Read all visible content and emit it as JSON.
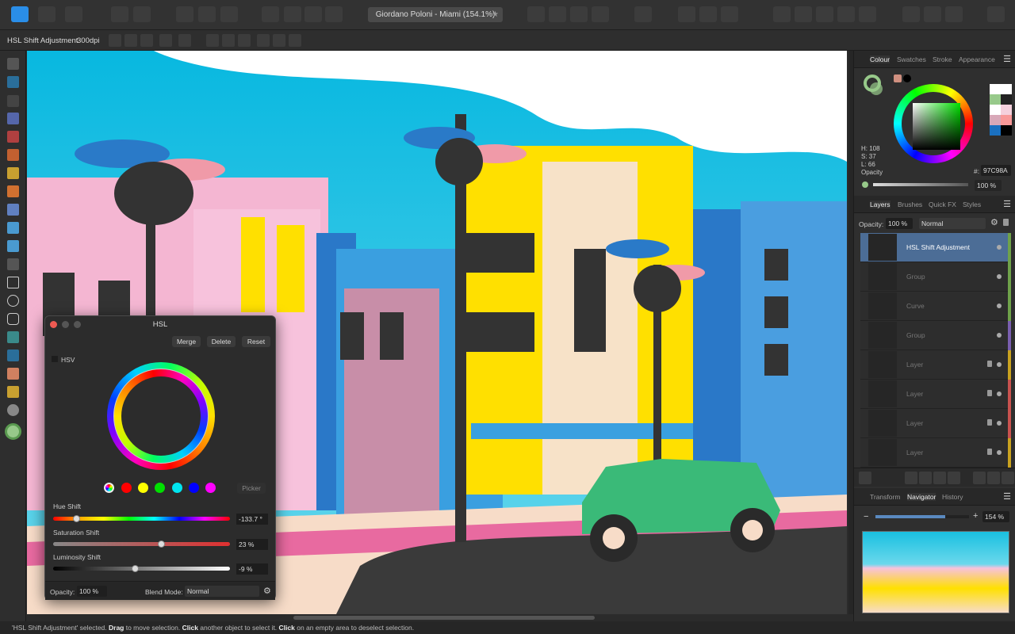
{
  "app": {
    "document_title": "Giordano Poloni - Miami (154.1%)"
  },
  "context_bar": {
    "selection": "HSL Shift Adjustment",
    "dpi": "300dpi"
  },
  "colour_panel": {
    "tabs": [
      "Colour",
      "Swatches",
      "Stroke",
      "Appearance"
    ],
    "h": "H: 108",
    "s": "S: 37",
    "l": "L: 66",
    "opacity_label": "Opacity",
    "hex_label": "#:",
    "hex": "97C98A",
    "opacity": "100 %",
    "current_colour": "#97C98A"
  },
  "layers_panel": {
    "tabs": [
      "Layers",
      "Brushes",
      "Quick FX",
      "Styles"
    ],
    "opacity_label": "Opacity:",
    "opacity": "100 %",
    "blend": "Normal",
    "layers": [
      {
        "name": "HSL Shift Adjustment",
        "selected": true,
        "tag": "#6fa24a"
      },
      {
        "name": "Group",
        "tag": "#6fa24a"
      },
      {
        "name": "Curve",
        "tag": "#6fa24a"
      },
      {
        "name": "Group",
        "tag": "#7a5fb0"
      },
      {
        "name": "Layer",
        "locked": true,
        "tag": "#c9a21f"
      },
      {
        "name": "Layer",
        "locked": true,
        "tag": "#c9524f"
      },
      {
        "name": "Layer",
        "locked": true,
        "tag": "#c9524f"
      },
      {
        "name": "Layer",
        "locked": true,
        "tag": "#c9a21f"
      },
      {
        "name": "Layer",
        "locked": true,
        "tag": "#c9a21f"
      }
    ]
  },
  "navigator_panel": {
    "tabs": [
      "Transform",
      "Navigator",
      "History"
    ],
    "zoom": "154 %",
    "zoom_minus": "−",
    "zoom_plus": "+"
  },
  "hsl_dialog": {
    "title": "HSL",
    "merge": "Merge",
    "delete": "Delete",
    "reset": "Reset",
    "hsv_label": "HSV",
    "picker": "Picker",
    "hue_label": "Hue Shift",
    "hue_value": "-133.7 °",
    "hue_fraction": 0.13,
    "sat_label": "Saturation Shift",
    "sat_value": "23 %",
    "sat_fraction": 0.61,
    "lum_label": "Luminosity Shift",
    "lum_value": "-9 %",
    "lum_fraction": 0.46,
    "opacity_label": "Opacity:",
    "opacity": "100 %",
    "blend_label": "Blend Mode:",
    "blend": "Normal",
    "swatches": [
      "#ff0000",
      "#ffff00",
      "#00e000",
      "#00e5f0",
      "#0000ff",
      "#ff00ff"
    ]
  },
  "status": {
    "p1": "'HSL Shift Adjustment' selected. ",
    "b1": "Drag",
    "p2": " to move selection. ",
    "b2": "Click",
    "p3": " another object to select it. ",
    "b3": "Click",
    "p4": " on an empty area to deselect selection."
  }
}
